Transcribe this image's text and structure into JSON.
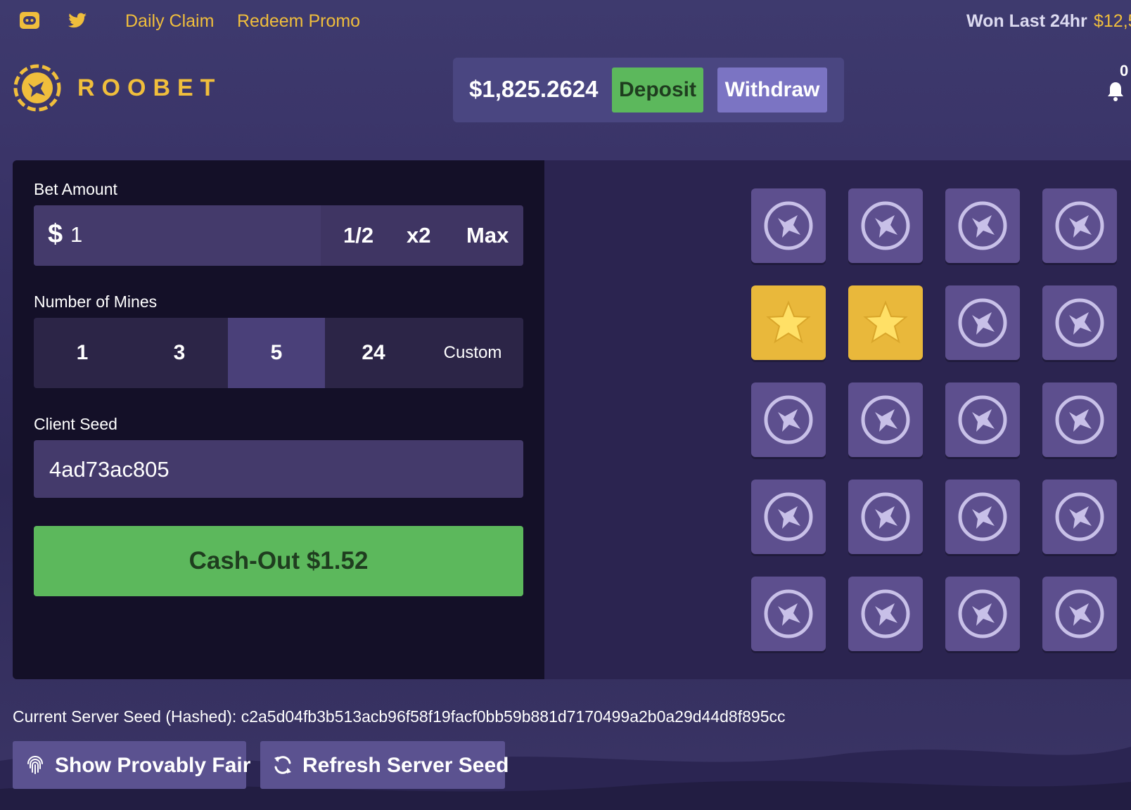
{
  "topbar": {
    "discord_icon": "discord-icon",
    "twitter_icon": "twitter-icon",
    "daily_claim": "Daily Claim",
    "redeem_promo": "Redeem Promo",
    "won_label": "Won Last 24hr",
    "won_value": "$12,5"
  },
  "brand": {
    "name": "ROOBET",
    "color": "#f0be3c"
  },
  "wallet": {
    "balance": "$1,825.2624",
    "deposit_label": "Deposit",
    "withdraw_label": "Withdraw",
    "notification_count": "0"
  },
  "bet": {
    "label": "Bet Amount",
    "currency_symbol": "$",
    "value": "1",
    "half": "1/2",
    "double": "x2",
    "max": "Max"
  },
  "mines": {
    "label": "Number of Mines",
    "options": [
      "1",
      "3",
      "5",
      "24",
      "Custom"
    ],
    "selected": "5"
  },
  "client_seed": {
    "label": "Client Seed",
    "value": "4ad73ac805"
  },
  "cashout": {
    "label": "Cash-Out $1.52"
  },
  "grid": {
    "columns": 4,
    "rows": 5,
    "revealed_gems": [
      [
        1,
        0
      ],
      [
        1,
        1
      ]
    ]
  },
  "server_seed": {
    "text": "Current Server Seed (Hashed): c2a5d04fb3b513acb96f58f19facf0bb59b881d7170499a2b0a29d44d8f895cc"
  },
  "actions": {
    "provably_fair": "Show Provably Fair",
    "refresh_seed": "Refresh Server Seed"
  },
  "colors": {
    "accent_green": "#5cb85c",
    "accent_purple": "#7b74c3",
    "gold": "#f0be3c",
    "tile": "#5d4f8e"
  }
}
